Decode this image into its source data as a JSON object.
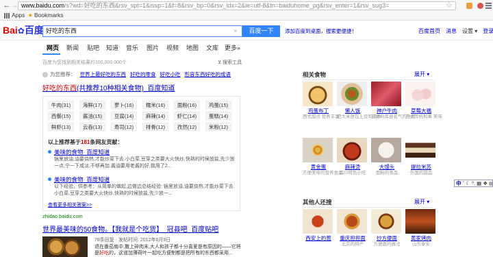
{
  "browser": {
    "url_host": "www.baidu.com",
    "url_path": "/s?wd=好吃的东西&rsv_spt=1&issp=1&f=8&rsv_bp=0&rsv_idx=2&ie=utf-8&tn=baiduhome_pg&rsv_enter=1&rsv_sug3=",
    "back_glyph": "←",
    "forward_glyph": "→",
    "reload_glyph": "C",
    "star_glyph": "☆",
    "apps_label": "Apps",
    "bookmarks_label": "Bookmarks"
  },
  "header": {
    "logo_bai": "Bai",
    "logo_du": "百度",
    "logo_paw": "✿",
    "search_value": "好吃的东西",
    "search_clear": "×",
    "search_button": "百度一下",
    "promo": "添加百度到桌面，搜索更便捷！",
    "links": [
      "百度首页",
      "消息",
      "设置 ▾",
      "登录"
    ]
  },
  "tabs": [
    "网页",
    "新闻",
    "贴吧",
    "知道",
    "音乐",
    "图片",
    "视频",
    "地图",
    "文库",
    "更多»"
  ],
  "result_count": "百度为您找到相关结果约100,000,000个",
  "tools": "搜索工具",
  "recommend": {
    "label": "为您推荐：",
    "keywords": [
      "世界上最好吃的东西",
      "好吃的零食",
      "好吃小吃",
      "形容东西好吃的成语"
    ]
  },
  "result1": {
    "title_em": "好吃的东西",
    "title_rest": "(共推荐10种相关食物)_百度知道"
  },
  "chips": [
    "牛肉(31)",
    "海鲜(17)",
    "萝卜(16)",
    "糯米(16)",
    "面粉(16)",
    "鸡蛋(15)",
    "西餐(15)",
    "酱油(15)",
    "豆腐(14)",
    "麻辣(14)",
    "虾仁(14)",
    "蛋糕(14)",
    "鲜虾(13)",
    "云吞(13)",
    "寿司(12)",
    "排骨(12)",
    "孜然(12)",
    "米粉(12)"
  ],
  "answers": {
    "header_pre": "以上推荐基于",
    "count": "181",
    "header_post": "条网友贡献：",
    "items": [
      {
        "title": "美味的食物_百度知道",
        "desc": "锅里放油,油要烧热,才能炒菜下去.小白菜,豆芽之类要大火快炒,快熟的时候放盐,先少放一点,宁一下咸淡,不够再加.酱油要用老酱的好,我用了2..."
      },
      {
        "title": "美味的食物_百度知道",
        "desc": "以下经验，供参考：从简单的做起,边做边总结经验: 锅里放油,油要烧热,才能炒菜下去.小白菜,豆芽之类要大火快炒,快熟的时候放盐,先少放一..."
      }
    ],
    "more": "查看更多相关答案>>"
  },
  "source1": "zhidao.baidu.com",
  "result3": {
    "title": "世界最美味的50食物。【我就是个吃货】_冠县吧_百度贴吧",
    "meta": "78条回复 · 发帖时间: 2012年6月9日",
    "desc_a": "退在番茄扇中,撒上碎肉末,大人和孩子都十分喜爱是有原因的——它将是",
    "desc_em": "好吃",
    "desc_b": "的，这道加薄荷叶一起吃方便制都是把所有的东西都采用..."
  },
  "sidebar": {
    "related_title": "相关食物",
    "expand": "展开 ▾",
    "foods": [
      {
        "name": "鸡蛋布丁",
        "desc": "西式甜点 营养丰富"
      },
      {
        "name": "懒人饭",
        "desc": "把大米放在土豆和四季"
      },
      {
        "name": "神户牛肉",
        "desc": "日本兵库县名气的牛肉"
      },
      {
        "name": "草莓大福",
        "desc": "日式传统和果 美味"
      },
      {
        "name": "黄金蛋",
        "desc": "方便美味的营养食品"
      },
      {
        "name": "麻辣烫",
        "desc": "四川特色小吃"
      },
      {
        "name": "大馒头",
        "desc": "面粉的食品"
      },
      {
        "name": "提拉米苏",
        "desc": "外国的甜品"
      }
    ],
    "others_title": "其他人还搜",
    "others": [
      {
        "name": "西安上的葱",
        "desc": ""
      },
      {
        "name": "重庆担担面",
        "desc": "北京的特产"
      },
      {
        "name": "炒方便面",
        "desc": "方便面的做法"
      },
      {
        "name": "黄家烤肉",
        "desc": "山东泰安"
      }
    ]
  },
  "ime": {
    "lang": "中",
    "rest": "ˇ ☾ ⁰,  ▦ ❖ ▤ ⌨"
  },
  "colors": {
    "accent": "#3385ff",
    "link": "#0000cc",
    "emphasis": "#c00000",
    "source": "#008000"
  }
}
